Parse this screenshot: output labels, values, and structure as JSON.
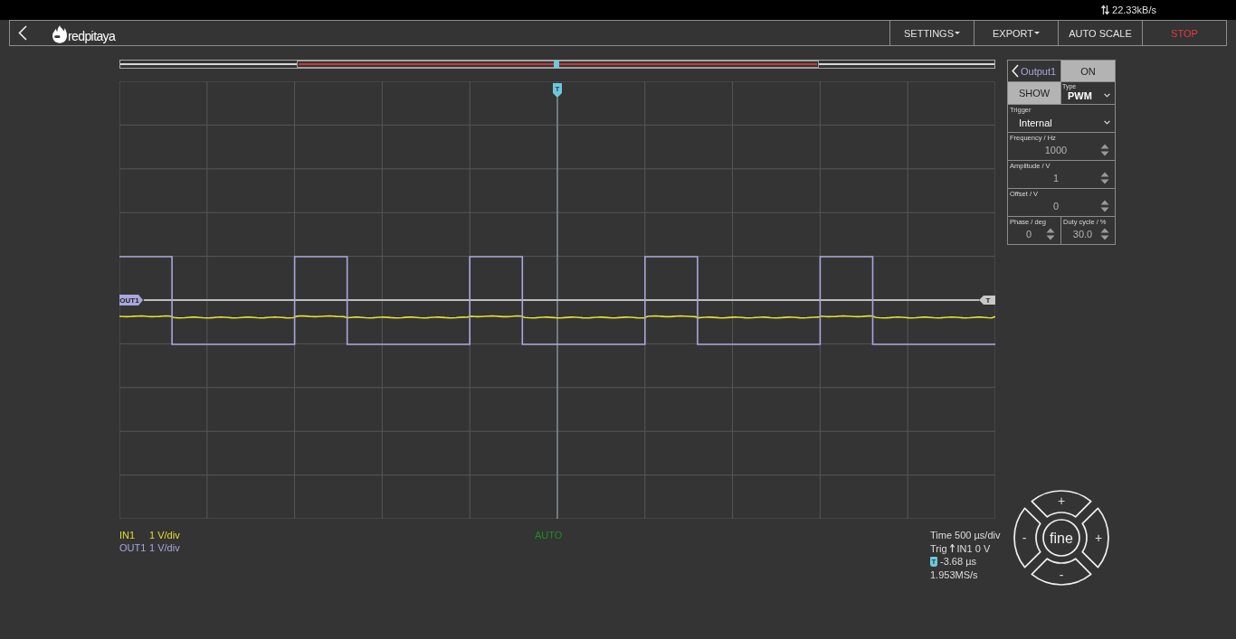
{
  "status_bar": {
    "data_rate": "22.33kB/s"
  },
  "header": {
    "logo_text": "redpitaya",
    "menu": [
      {
        "label": "SETTINGS",
        "kind": "dropdown"
      },
      {
        "label": "EXPORT",
        "kind": "dropdown"
      },
      {
        "label": "AUTO SCALE",
        "kind": "action"
      },
      {
        "label": "STOP",
        "kind": "stop"
      }
    ]
  },
  "plot": {
    "trigger_marker": "T",
    "channel_marker": "OUT1",
    "level_marker": "T"
  },
  "channels": [
    {
      "name": "IN1",
      "scale": "1 V/div",
      "color": "#e3df2e"
    },
    {
      "name": "OUT1",
      "scale": "1 V/div",
      "color": "#a9a6dd"
    }
  ],
  "trigger_mode": "AUTO",
  "acquisition": {
    "time": "Time 500 µs/div",
    "trigger_label": "Trig",
    "trigger_source": "IN1 0 V",
    "trigger_marker": "T",
    "trigger_offset": "-3.68 µs",
    "sample_rate": "1.953MS/s"
  },
  "fine_control": {
    "label": "fine",
    "segments": [
      {
        "kind": "top",
        "label": "+"
      },
      {
        "kind": "left",
        "label": "-"
      },
      {
        "kind": "right",
        "label": "+"
      },
      {
        "kind": "bottom",
        "label": "-"
      }
    ]
  },
  "output_panel": {
    "title": "Output1",
    "power": {
      "label": "ON",
      "active": true
    },
    "visibility": {
      "label": "SHOW",
      "active": true
    },
    "type_select": {
      "label": "Type",
      "value": "PWM"
    },
    "trigger_select": {
      "label": "Trigger",
      "value": "Internal"
    },
    "fields": [
      {
        "label": "Frequency / Hz",
        "value": "1000"
      },
      {
        "label": "Amplitude / V",
        "value": "1"
      },
      {
        "label": "Offset / V",
        "value": "0"
      }
    ],
    "half_fields": [
      {
        "label": "Phase / deg",
        "value": "0"
      },
      {
        "label": "Duty cycle / %",
        "value": "30.0"
      }
    ]
  }
}
